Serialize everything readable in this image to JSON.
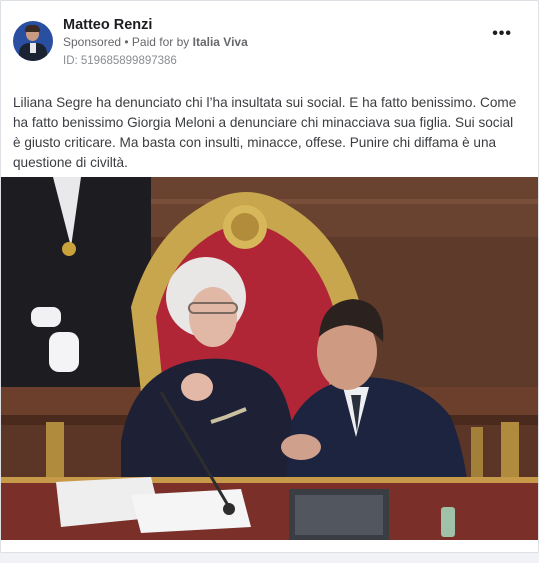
{
  "post": {
    "author": "Matteo Renzi",
    "sponsored": "Sponsored",
    "separator": " • ",
    "paid_for_prefix": "Paid for by ",
    "paid_for_by": "Italia Viva",
    "ad_id": "ID: 519685899897386",
    "more_icon": "more-horizontal-icon",
    "text": "Liliana Segre ha denunciato chi l’ha insultata sui social. E ha fatto benissimo. Come ha fatto benissimo Giorgia Meloni a denunciare chi minacciava sua figlia. Sui social è giusto criticare. Ma basta con insulti, minacce, offese. Punire chi diffama è una questione di civiltà."
  },
  "colors": {
    "author": "#1c1e21",
    "meta": "#65676b",
    "body_text": "#3b3d40"
  }
}
